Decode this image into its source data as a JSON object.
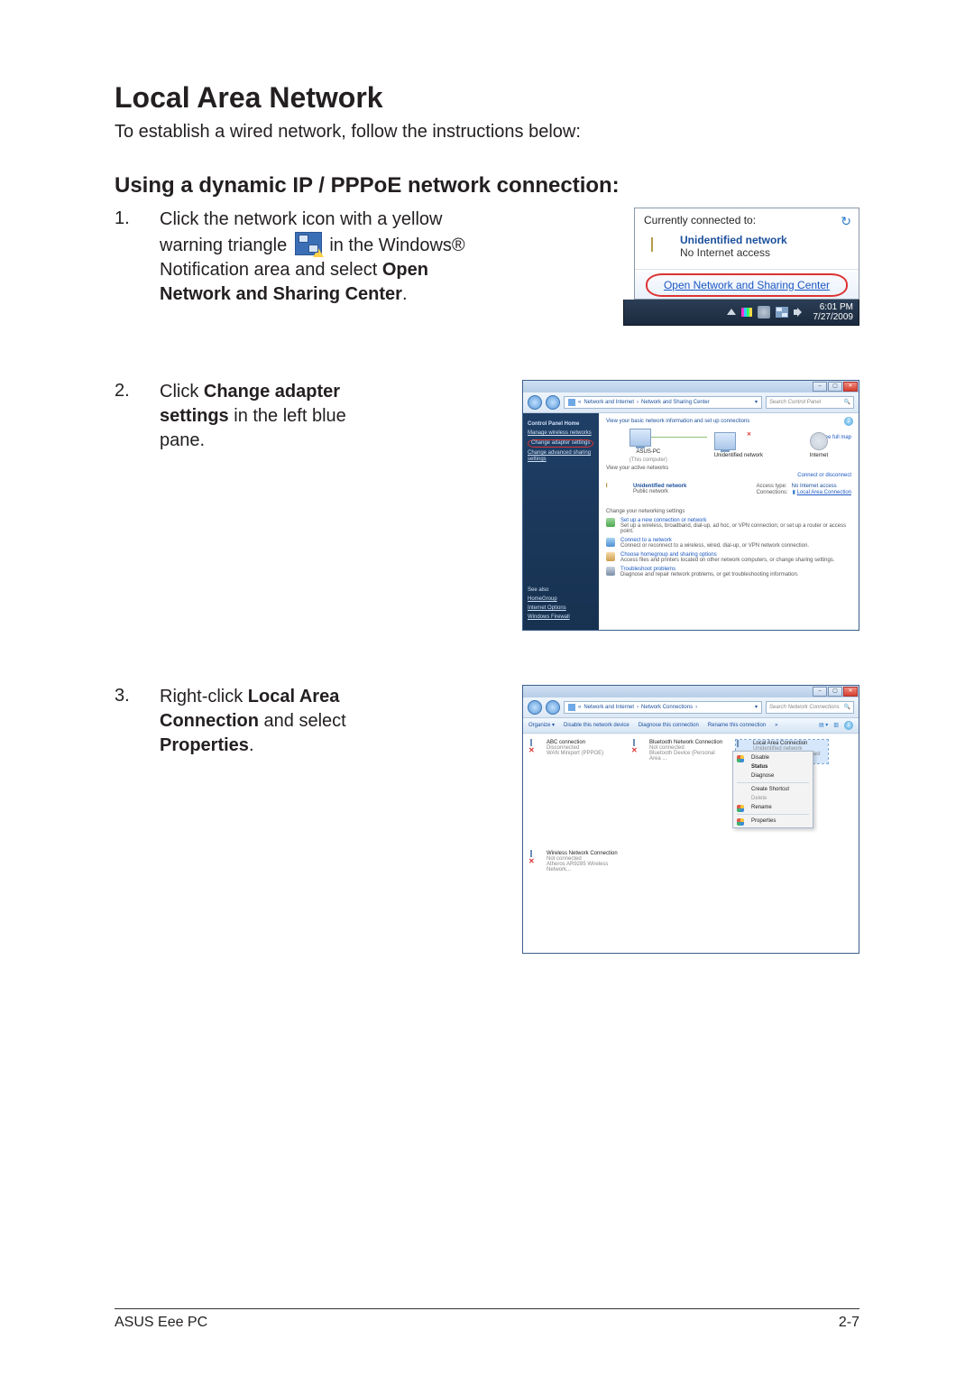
{
  "heading": "Local Area Network",
  "intro": "To establish a wired network, follow the instructions below:",
  "section": "Using a dynamic IP / PPPoE network connection:",
  "steps": {
    "one": {
      "num": "1.",
      "pre": "Click the network icon with a yellow warning triangle ",
      "mid": " in the Windows® Notification area and select ",
      "bold": "Open Network and Sharing Center",
      "end": "."
    },
    "two": {
      "num": "2.",
      "pre": "Click ",
      "bold": "Change adapter settings",
      "post": " in the left blue pane."
    },
    "three": {
      "num": "3.",
      "pre": "Right-click ",
      "bold1": "Local Area Connection",
      "mid": " and select ",
      "bold2": "Properties",
      "end": "."
    }
  },
  "popup": {
    "header": "Currently connected to:",
    "net_name": "Unidentified network",
    "net_status": "No Internet access",
    "open_link": "Open Network and Sharing Center"
  },
  "taskbar": {
    "time": "6:01 PM",
    "date": "7/27/2009"
  },
  "nsc": {
    "breadcrumb_1": "Network and Internet",
    "breadcrumb_2": "Network and Sharing Center",
    "search_placeholder": "Search Control Panel",
    "side": {
      "home": "Control Panel Home",
      "l1": "Manage wireless networks",
      "l2": "Change adapter settings",
      "l3": "Change advanced sharing settings",
      "see_also": "See also",
      "s1": "HomeGroup",
      "s2": "Internet Options",
      "s3": "Windows Firewall"
    },
    "main": {
      "title": "View your basic network information and set up connections",
      "see_full": "See full map",
      "pc": "ASUS-PC",
      "pc_sub": "(This computer)",
      "unid": "Unidentified network",
      "inet": "Internet",
      "view_active": "View your active networks",
      "conn_disc": "Connect or disconnect",
      "net_name": "Unidentified network",
      "net_type": "Public network",
      "access_k": "Access type:",
      "access_v": "No Internet access",
      "conn_k": "Connections:",
      "conn_v": "Local Area Connection",
      "change_settings": "Change your networking settings",
      "t1": "Set up a new connection or network",
      "t1d": "Set up a wireless, broadband, dial-up, ad hoc, or VPN connection; or set up a router or access point.",
      "t2": "Connect to a network",
      "t2d": "Connect or reconnect to a wireless, wired, dial-up, or VPN network connection.",
      "t3": "Choose homegroup and sharing options",
      "t3d": "Access files and printers located on other network computers, or change sharing settings.",
      "t4": "Troubleshoot problems",
      "t4d": "Diagnose and repair network problems, or get troubleshooting information."
    }
  },
  "nc": {
    "breadcrumb_1": "Network and Internet",
    "breadcrumb_2": "Network Connections",
    "search_placeholder": "Search Network Connections",
    "toolbar": {
      "organize": "Organize",
      "disable": "Disable this network device",
      "diagnose": "Diagnose this connection",
      "rename": "Rename this connection"
    },
    "conns": {
      "abc": {
        "l1": "ABC connection",
        "l2": "Disconnected",
        "l3": "WAN Miniport (PPPOE)"
      },
      "bt": {
        "l1": "Bluetooth Network Connection",
        "l2": "Not connected",
        "l3": "Bluetooth Device (Personal Area ..."
      },
      "lac": {
        "l1": "Local Area Connection",
        "l2": "Unidentified network",
        "l3": "Atheros AR8132 PCI-E Fast Ethern..."
      },
      "wnc": {
        "l1": "Wireless Network Connection",
        "l2": "Not connected",
        "l3": "Atheros AR9285 Wireless Network..."
      }
    },
    "menu": {
      "disable": "Disable",
      "status": "Status",
      "diagnose": "Diagnose",
      "shortcut": "Create Shortcut",
      "delete": "Delete",
      "rename": "Rename",
      "properties": "Properties"
    }
  },
  "footer": {
    "left": "ASUS Eee PC",
    "right": "2-7"
  }
}
